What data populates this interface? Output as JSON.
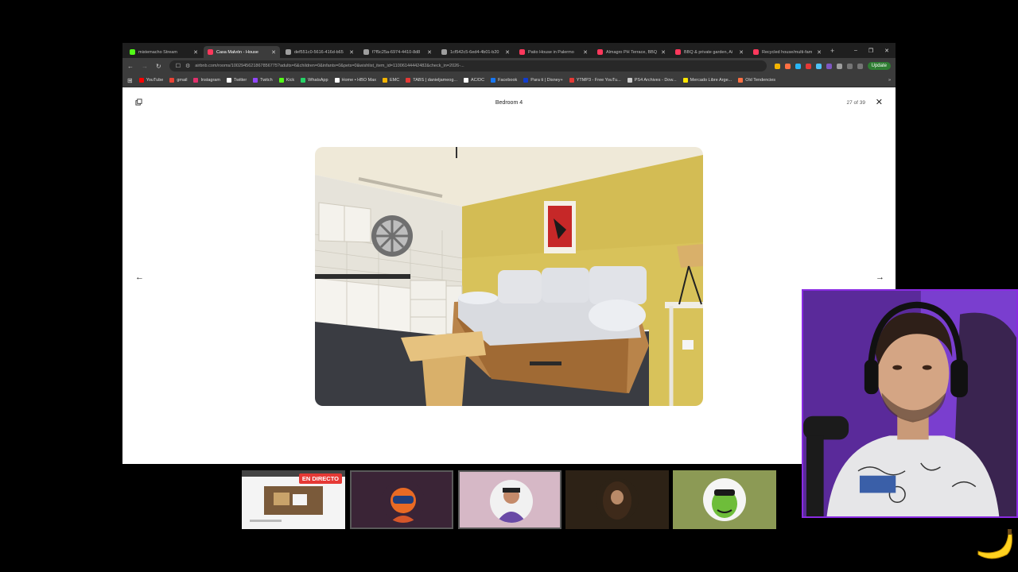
{
  "browser": {
    "tabs": [
      {
        "label": "mistemacho Stream",
        "active": false,
        "color": "#53fc18"
      },
      {
        "label": "Casa Malvón - House",
        "active": true,
        "color": "#ff385c"
      },
      {
        "label": "def551c0-5616-416d-b65",
        "active": false,
        "color": "#9e9e9e"
      },
      {
        "label": "f7f5c25a-6974-4410-8d8",
        "active": false,
        "color": "#9e9e9e"
      },
      {
        "label": "1cf542c5-6ed4-4b01-b20",
        "active": false,
        "color": "#9e9e9e"
      },
      {
        "label": "Patio House in Palermo",
        "active": false,
        "color": "#ff385c"
      },
      {
        "label": "Almagro PH Terrace, BBQ",
        "active": false,
        "color": "#ff385c"
      },
      {
        "label": "BBQ & private garden, Ai",
        "active": false,
        "color": "#ff385c"
      },
      {
        "label": "Recycled house/multi-fam",
        "active": false,
        "color": "#ff385c"
      }
    ],
    "new_tab": "+",
    "url": "airbnb.com/rooms/1002945621867856775?adults=6&children=0&infants=0&pets=0&wishlist_item_id=11006144442482&check_in=2026-...",
    "update_label": "Update",
    "bookmarks": [
      {
        "label": "YouTube",
        "color": "#ff0000"
      },
      {
        "label": "gmail",
        "color": "#ea4335"
      },
      {
        "label": "Instagram",
        "color": "#e1306c"
      },
      {
        "label": "Twitter",
        "color": "#ffffff"
      },
      {
        "label": "Twitch",
        "color": "#9146ff"
      },
      {
        "label": "Kick",
        "color": "#53fc18"
      },
      {
        "label": "WhatsApp",
        "color": "#25d366"
      },
      {
        "label": "Home • HBO Max",
        "color": "#ffffff"
      },
      {
        "label": "EMC",
        "color": "#f4b400"
      },
      {
        "label": "TABS | danieljameog...",
        "color": "#e53935"
      },
      {
        "label": "AC/DC",
        "color": "#ffffff"
      },
      {
        "label": "Facebook",
        "color": "#1877f2"
      },
      {
        "label": "Para ti | Disney+",
        "color": "#113ccf"
      },
      {
        "label": "YTMP3 - Free YouTu...",
        "color": "#e53935"
      },
      {
        "label": "PS4 Archives - Dow...",
        "color": "#cccccc"
      },
      {
        "label": "Mercado Libre Arge...",
        "color": "#ffe600"
      },
      {
        "label": "Old Tendencies",
        "color": "#ff7043"
      }
    ],
    "bookmarks_more": "»"
  },
  "gallery": {
    "title": "Bedroom 4",
    "counter": "27 of 39",
    "close": "✕",
    "prev": "←",
    "next": "→"
  },
  "stream": {
    "live_badge": "EN DIRECTO"
  }
}
